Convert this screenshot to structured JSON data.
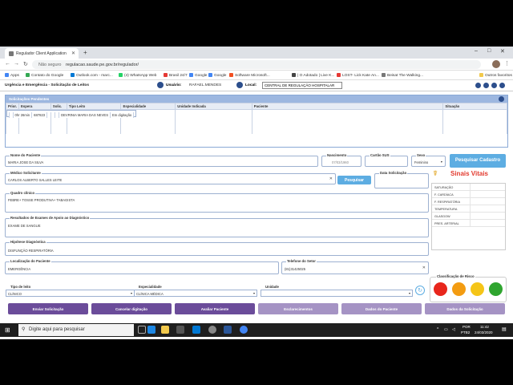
{
  "browser": {
    "tab_title": "Regulador Client Application",
    "url_prefix": "Não seguro",
    "url": "regulacao.saude.pe.gov.br/regulador/",
    "bookmarks": [
      {
        "label": "Apps",
        "color": "#4285f4"
      },
      {
        "label": "Contato do Google",
        "color": "#34a853"
      },
      {
        "label": "Outlook.com - marc...",
        "color": "#0078d4"
      },
      {
        "label": "(4) WhatsApp Web",
        "color": "#25d366"
      },
      {
        "label": "Brasil 24/7",
        "color": "#e53935"
      },
      {
        "label": "Google",
        "color": "#4285f4"
      },
      {
        "label": "Google",
        "color": "#4285f4"
      },
      {
        "label": "Software Microsoft...",
        "color": "#f25022"
      },
      {
        "label": "| O Adotado | Live K...",
        "color": "#444444"
      },
      {
        "label": "LOST- Lick Kate An...",
        "color": "#e53935"
      },
      {
        "label": "Beisat The Walking...",
        "color": "#777777"
      },
      {
        "label": "Outros favoritos",
        "color": "#f2c94c"
      }
    ]
  },
  "header": {
    "title": "Urgência e Emergência - Solicitação de Leitos",
    "user_label": "Usuário:",
    "user_value": "RAFAEL.MENDES",
    "location_label": "Local:",
    "location_value": "CENTRAL DE REGULAÇÃO HOSPITALAR"
  },
  "pending": {
    "title": "Solicitações Pendentes",
    "columns": [
      "Prior.",
      "Espera",
      "Solic.",
      "Tipo Leito",
      "Especialidade",
      "Unidade Indicada",
      "Paciente",
      "Situação"
    ],
    "rows": [
      [
        "",
        "0hr 26min",
        "687823",
        "",
        "",
        "",
        "DEVRINIA MARIA DAS NEVES",
        "Em digitação"
      ]
    ]
  },
  "form": {
    "nome_label": "Nome do Paciente",
    "nome_value": "MARIA JOSE DA SILVA",
    "nasc_label": "Nascimento",
    "nasc_value": "07/03/1960",
    "sus_label": "Cartão SUS",
    "sus_value": "",
    "sexo_label": "Sexo",
    "sexo_value": "Feminino",
    "pesq_cadastro": "Pesquisar Cadastro",
    "medico_label": "Médico Solicitante",
    "medico_value": "CARLOS ALBERTO SALLES LEITE",
    "pesquisar": "Pesquisar",
    "data_sol_label": "Data Solicitação",
    "quadro_label": "Quadro clínico",
    "quadro_value": "FEBRE+ TOSSE PRODUTIVA+ TABAGISTA",
    "exames_label": "Resultados de Exames de Apoio ao Diagnóstico",
    "exames_value": "EXAME DE SANGUE",
    "hipotese_label": "Hipótese Diagnóstica",
    "hipotese_value": "DISFUNÇÃO RESPIRATÓRIA",
    "local_label": "Localização do Paciente",
    "local_value": "EMERGÊNCIA",
    "tel_label": "Telefone do Setor",
    "tel_value": "(81)31425025",
    "tipo_label": "Tipo de leito",
    "tipo_value": "CLÍNICO",
    "esp_label": "Especialidade",
    "esp_value": "CLÍNICA MÉDICA",
    "unid_label": "Unidade",
    "unid_value": ""
  },
  "vitals": {
    "title": "Sinais Vitais",
    "items": [
      "SATURAÇÃO",
      "F. CARDÍACA",
      "F. RESPIRATÓRIA",
      "TEMPERATURA",
      "GLASGOW",
      "PRES. ARTERIAL"
    ]
  },
  "risk": {
    "label": "Classificação de Risco",
    "colors": [
      "#e8261c",
      "#f39c12",
      "#f5c518",
      "#2fa52f"
    ]
  },
  "actions": [
    {
      "label": "Enviar Solicitação",
      "color": "#6b4c9a"
    },
    {
      "label": "Cancelar digitação",
      "color": "#6b4c9a"
    },
    {
      "label": "Avaliar Paciente",
      "color": "#6b4c9a"
    },
    {
      "label": "Esclarecimentos",
      "color": "#a593c4"
    },
    {
      "label": "Dados do Paciente",
      "color": "#a593c4"
    },
    {
      "label": "Dados da Solicitação",
      "color": "#a593c4"
    }
  ],
  "taskbar": {
    "search_placeholder": "Digite aqui para pesquisar",
    "lang": "POR",
    "lang2": "PTB2",
    "time": "11:42",
    "date": "24/03/2020"
  }
}
